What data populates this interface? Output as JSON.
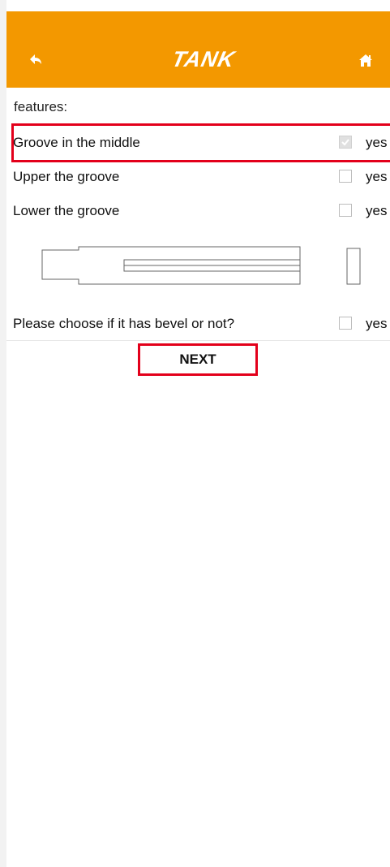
{
  "header": {
    "brand": "TANK",
    "back_icon": "back-arrow-icon",
    "home_icon": "home-icon",
    "bar_color": "#f39800"
  },
  "features": {
    "title": "features:",
    "items": [
      {
        "label": "Groove in the middle",
        "option": "yes",
        "checked": true
      },
      {
        "label": "Upper the groove",
        "option": "yes",
        "checked": false
      },
      {
        "label": "Lower the groove",
        "option": "yes",
        "checked": false
      }
    ],
    "bevel": {
      "label": "Please choose if it has bevel or not?",
      "option": "yes",
      "checked": false
    }
  },
  "actions": {
    "next_label": "NEXT"
  },
  "highlight_color": "#e3001b"
}
